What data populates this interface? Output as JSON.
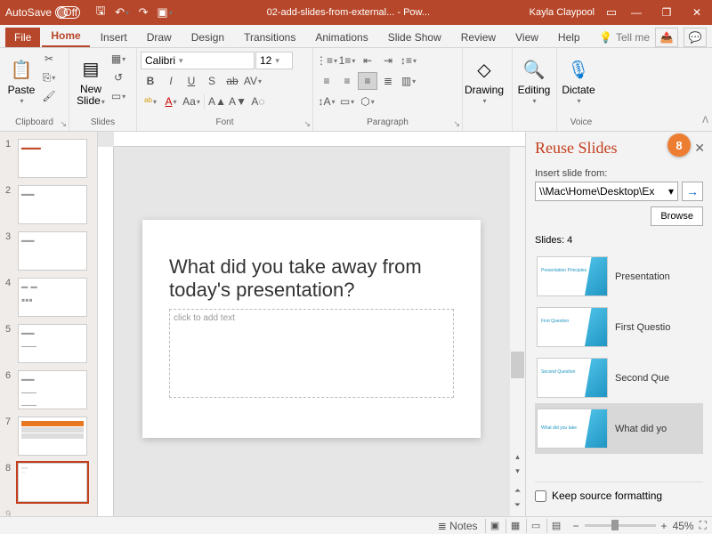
{
  "titlebar": {
    "autosave_label": "AutoSave",
    "autosave_state": "Off",
    "doc_title": "02-add-slides-from-external... - Pow...",
    "user": "Kayla Claypool"
  },
  "tabs": {
    "file": "File",
    "home": "Home",
    "insert": "Insert",
    "draw": "Draw",
    "design": "Design",
    "transitions": "Transitions",
    "animations": "Animations",
    "slideshow": "Slide Show",
    "review": "Review",
    "view": "View",
    "help": "Help",
    "tellme": "Tell me"
  },
  "ribbon": {
    "clipboard": {
      "label": "Clipboard",
      "paste": "Paste"
    },
    "slides": {
      "label": "Slides",
      "new_slide": "New\nSlide"
    },
    "font": {
      "label": "Font",
      "name": "Calibri",
      "size": "12"
    },
    "paragraph": {
      "label": "Paragraph"
    },
    "drawing": {
      "label": "Drawing",
      "btn": "Drawing"
    },
    "editing": {
      "label": "Editing",
      "btn": "Editing"
    },
    "voice": {
      "label": "Voice",
      "dictate": "Dictate"
    }
  },
  "thumbs": [
    "1",
    "2",
    "3",
    "4",
    "5",
    "6",
    "7",
    "8"
  ],
  "slide": {
    "title": "What did you take away from today's presentation?",
    "placeholder": "click to add text"
  },
  "reuse": {
    "title": "Reuse Slides",
    "callout": "8",
    "insert_label": "Insert slide from:",
    "path": "\\\\Mac\\Home\\Desktop\\Ex",
    "browse": "Browse",
    "count": "Slides: 4",
    "items": [
      {
        "name": "Presentation"
      },
      {
        "name": "First Questio"
      },
      {
        "name": "Second Que"
      },
      {
        "name": "What did yo"
      }
    ],
    "keep_fmt": "Keep source formatting"
  },
  "status": {
    "notes": "Notes",
    "zoom": "45%"
  }
}
